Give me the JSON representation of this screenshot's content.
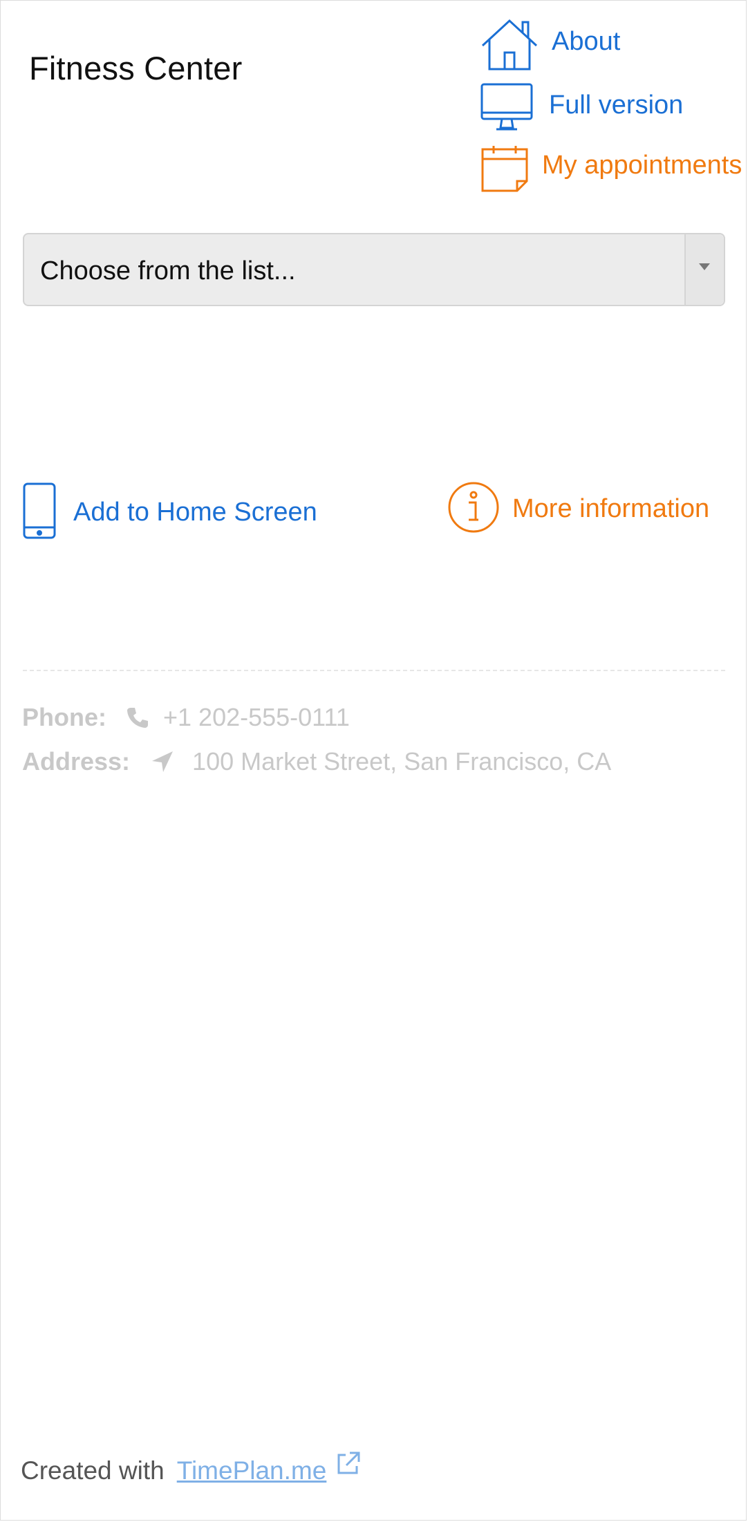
{
  "header": {
    "title": "Fitness Center"
  },
  "nav": {
    "about": "About",
    "full_version": "Full version",
    "my_appointments": "My appointments"
  },
  "select": {
    "placeholder": "Choose from the list..."
  },
  "actions": {
    "add_home": "Add to Home Screen",
    "more_info": "More information"
  },
  "contact": {
    "phone_label": "Phone:",
    "phone_value": "+1 202-555-0111",
    "address_label": "Address:",
    "address_value": "100 Market Street, San Francisco, CA"
  },
  "footer": {
    "created_with": "Created with",
    "link_text": "TimePlan.me"
  },
  "colors": {
    "accent_blue": "#1a6fd4",
    "accent_orange": "#f07a10",
    "muted": "#c8c8c8"
  },
  "icons": {
    "about": "home-icon",
    "full_version": "monitor-icon",
    "my_appointments": "calendar-icon",
    "add_home": "phone-device-icon",
    "more_info": "info-icon",
    "phone": "phone-icon",
    "address": "location-arrow-icon",
    "external": "external-link-icon"
  }
}
